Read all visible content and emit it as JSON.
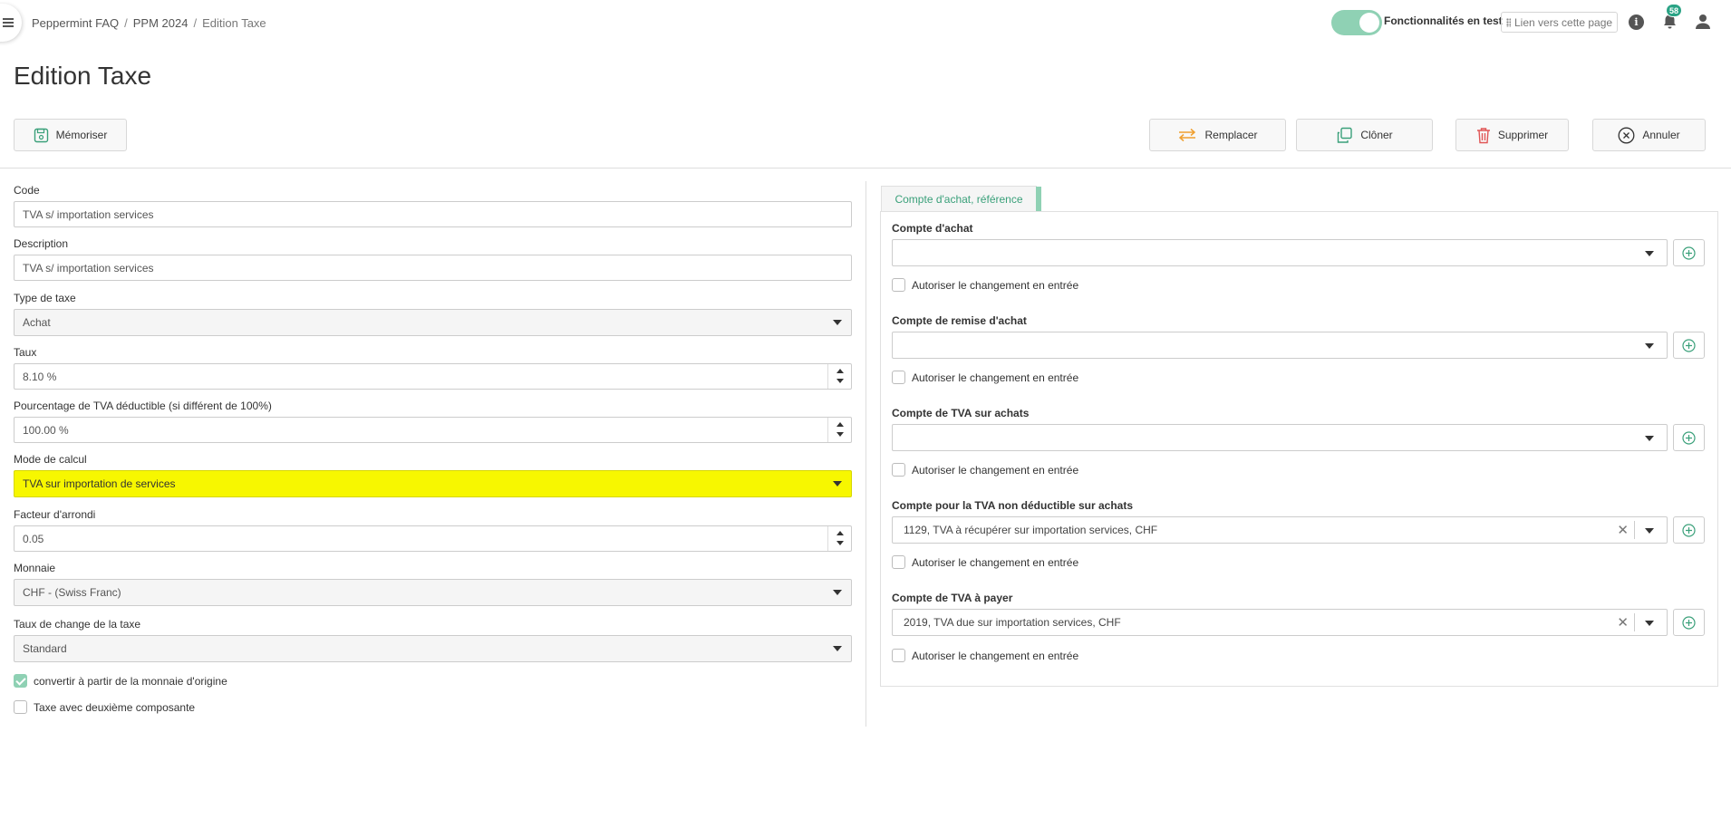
{
  "breadcrumb": {
    "items": [
      "Peppermint FAQ",
      "PPM 2024"
    ],
    "current": "Edition Taxe",
    "separator": "/"
  },
  "header": {
    "feature_label": "Fonctionnalités en test",
    "link_label": "Lien vers cette page",
    "notification_count": "58"
  },
  "page": {
    "title": "Edition Taxe"
  },
  "toolbar": {
    "save_label": "Mémoriser",
    "replace_label": "Remplacer",
    "clone_label": "Clôner",
    "delete_label": "Supprimer",
    "cancel_label": "Annuler"
  },
  "form": {
    "code": {
      "label": "Code",
      "value": "TVA s/ importation services"
    },
    "description": {
      "label": "Description",
      "value": "TVA s/ importation services"
    },
    "tax_type": {
      "label": "Type de taxe",
      "value": "Achat"
    },
    "rate": {
      "label": "Taux",
      "value": "8.10 %"
    },
    "deductible": {
      "label": "Pourcentage de TVA déductible (si différent de 100%)",
      "value": "100.00 %"
    },
    "calc_mode": {
      "label": "Mode de calcul",
      "value": "TVA sur importation de services"
    },
    "rounding": {
      "label": "Facteur d'arrondi",
      "value": "0.05"
    },
    "currency": {
      "label": "Monnaie",
      "value": "CHF - (Swiss Franc)"
    },
    "exchange_rate": {
      "label": "Taux de change de la taxe",
      "value": "Standard"
    },
    "convert_checkbox": {
      "label": "convertir à partir de la monnaie d'origine",
      "checked": true
    },
    "second_component_checkbox": {
      "label": "Taxe avec deuxième composante",
      "checked": false
    }
  },
  "accounts_panel": {
    "tab_label": "Compte d'achat, référence",
    "allow_change_label": "Autoriser le changement en entrée",
    "purchase": {
      "label": "Compte d'achat",
      "value": ""
    },
    "purchase_discount": {
      "label": "Compte de remise d'achat",
      "value": ""
    },
    "purchase_vat": {
      "label": "Compte de TVA sur achats",
      "value": ""
    },
    "non_deductible_vat": {
      "label": "Compte pour la TVA non déductible sur achats",
      "value": "1129, TVA à récupérer sur importation services, CHF"
    },
    "vat_payable": {
      "label": "Compte de TVA à payer",
      "value": "2019, TVA due sur importation services, CHF"
    }
  },
  "colors": {
    "accent": "#8fd1b4",
    "accent_text": "#3aa07a",
    "highlight": "#f7f700",
    "badge": "#2aa385",
    "delete_icon": "#e05555",
    "replace_icon": "#f0a030"
  },
  "icons": {
    "menu": "hamburger-icon",
    "info": "info-icon",
    "notifications": "bell-icon",
    "user": "user-icon",
    "save": "floppy-icon",
    "replace": "swap-arrows-icon",
    "clone": "copy-icon",
    "delete": "trash-icon",
    "cancel": "circle-x-icon",
    "add": "plus-circle-icon",
    "clear": "close-icon"
  }
}
